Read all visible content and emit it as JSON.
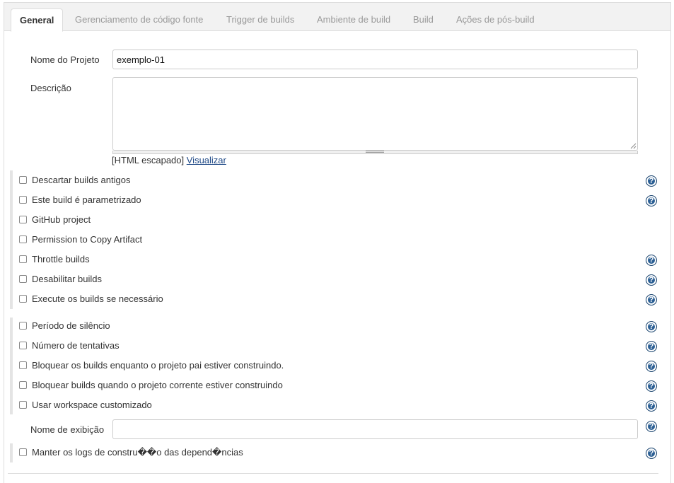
{
  "tabs": [
    {
      "label": "General",
      "active": true
    },
    {
      "label": "Gerenciamento de código fonte"
    },
    {
      "label": "Trigger de builds"
    },
    {
      "label": "Ambiente de build"
    },
    {
      "label": "Build"
    },
    {
      "label": "Ações de pós-build"
    }
  ],
  "project": {
    "name_label": "Nome do Projeto",
    "name_value": "exemplo-01",
    "description_label": "Descrição",
    "description_value": "",
    "html_note": "[HTML escapado]",
    "preview_link": "Visualizar"
  },
  "options_group1": [
    {
      "label": "Descartar builds antigos",
      "checked": false,
      "help": true
    },
    {
      "label": "Este build é parametrizado",
      "checked": false,
      "help": true
    },
    {
      "label": "GitHub project",
      "checked": false,
      "help": false
    },
    {
      "label": "Permission to Copy Artifact",
      "checked": false,
      "help": false
    },
    {
      "label": "Throttle builds",
      "checked": false,
      "help": true
    },
    {
      "label": "Desabilitar builds",
      "checked": false,
      "help": true
    },
    {
      "label": "Execute os builds se necessário",
      "checked": false,
      "help": true
    }
  ],
  "options_group2": [
    {
      "label": "Período de silêncio",
      "checked": false,
      "help": true
    },
    {
      "label": "Número de tentativas",
      "checked": false,
      "help": true
    },
    {
      "label": "Bloquear os builds enquanto o projeto pai estiver construindo.",
      "checked": false,
      "help": true
    },
    {
      "label": "Bloquear builds quando o projeto corrente estiver construindo",
      "checked": false,
      "help": true
    },
    {
      "label": "Usar workspace customizado",
      "checked": false,
      "help": true
    }
  ],
  "display_name": {
    "label": "Nome de exibição",
    "value": ""
  },
  "keep_logs": {
    "label": "Manter os logs de constru��o das depend�ncias",
    "checked": false
  },
  "help_glyph": "?",
  "colors": {
    "help_icon": "#2b5f94",
    "link": "#204a87",
    "tab_bar": "#f2f2f2"
  }
}
